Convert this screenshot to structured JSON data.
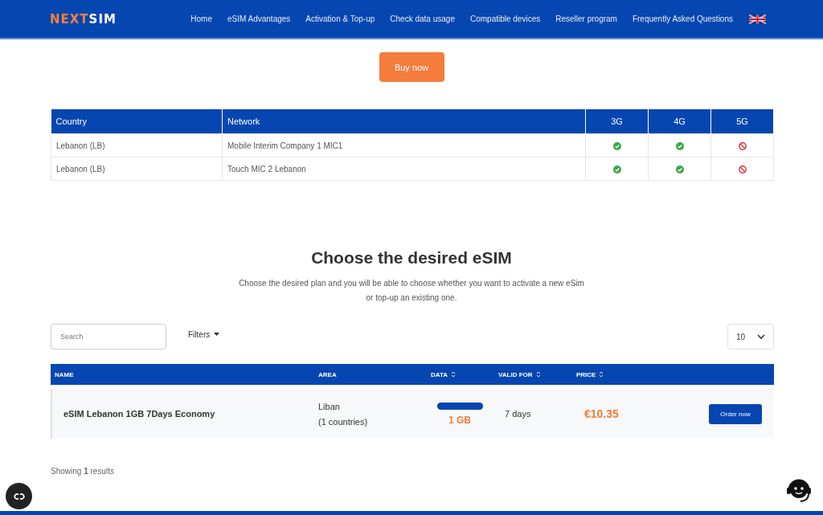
{
  "header": {
    "logo": {
      "first": "NEXT",
      "second": "SIM"
    },
    "nav": [
      "Home",
      "eSIM Advantages",
      "Activation & Top-up",
      "Check data usage",
      "Compatible devices",
      "Reseller program",
      "Frequently Asked Questions"
    ]
  },
  "buy_button": "Buy now",
  "coverage": {
    "columns": [
      "Country",
      "Network",
      "3G",
      "4G",
      "5G"
    ],
    "rows": [
      {
        "country": "Lebanon (LB)",
        "network": "Mobile Interim Company 1 MIC1",
        "support": [
          true,
          true,
          false
        ]
      },
      {
        "country": "Lebanon (LB)",
        "network": "Touch MIC 2 Lebanon",
        "support": [
          true,
          true,
          false
        ]
      }
    ]
  },
  "plans": {
    "title": "Choose the desired eSIM",
    "subtitle": "Choose the desired plan and you will be able to choose whether you want to activate a new eSim or top-up an existing one.",
    "search": {
      "placeholder": "Search"
    },
    "filters": "Filters",
    "page_size": "10",
    "columns": [
      {
        "label": "NAME",
        "sortable": false
      },
      {
        "label": "AREA",
        "sortable": false
      },
      {
        "label": "DATA",
        "sortable": true
      },
      {
        "label": "VALID FOR",
        "sortable": true
      },
      {
        "label": "PRICE",
        "sortable": true
      }
    ],
    "rows": [
      {
        "name": "eSIM Lebanon 1GB 7Days Economy",
        "area": "Liban",
        "area_count": "(1 countries)",
        "data": "1 GB",
        "level": 1,
        "valid": "7 days",
        "price": "€10.35",
        "action": "Order now"
      }
    ],
    "results": "Showing **1** results"
  }
}
